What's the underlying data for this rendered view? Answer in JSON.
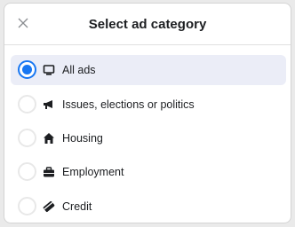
{
  "dialog": {
    "title": "Select ad category",
    "close_icon": "close-icon"
  },
  "options": [
    {
      "label": "All ads",
      "icon": "monitor-icon",
      "selected": true
    },
    {
      "label": "Issues, elections or politics",
      "icon": "megaphone-icon",
      "selected": false
    },
    {
      "label": "Housing",
      "icon": "house-icon",
      "selected": false
    },
    {
      "label": "Employment",
      "icon": "briefcase-icon",
      "selected": false
    },
    {
      "label": "Credit",
      "icon": "credit-card-icon",
      "selected": false
    }
  ],
  "colors": {
    "accent": "#1877f2",
    "selected_row": "#ebedf7",
    "text": "#1c1e21"
  }
}
